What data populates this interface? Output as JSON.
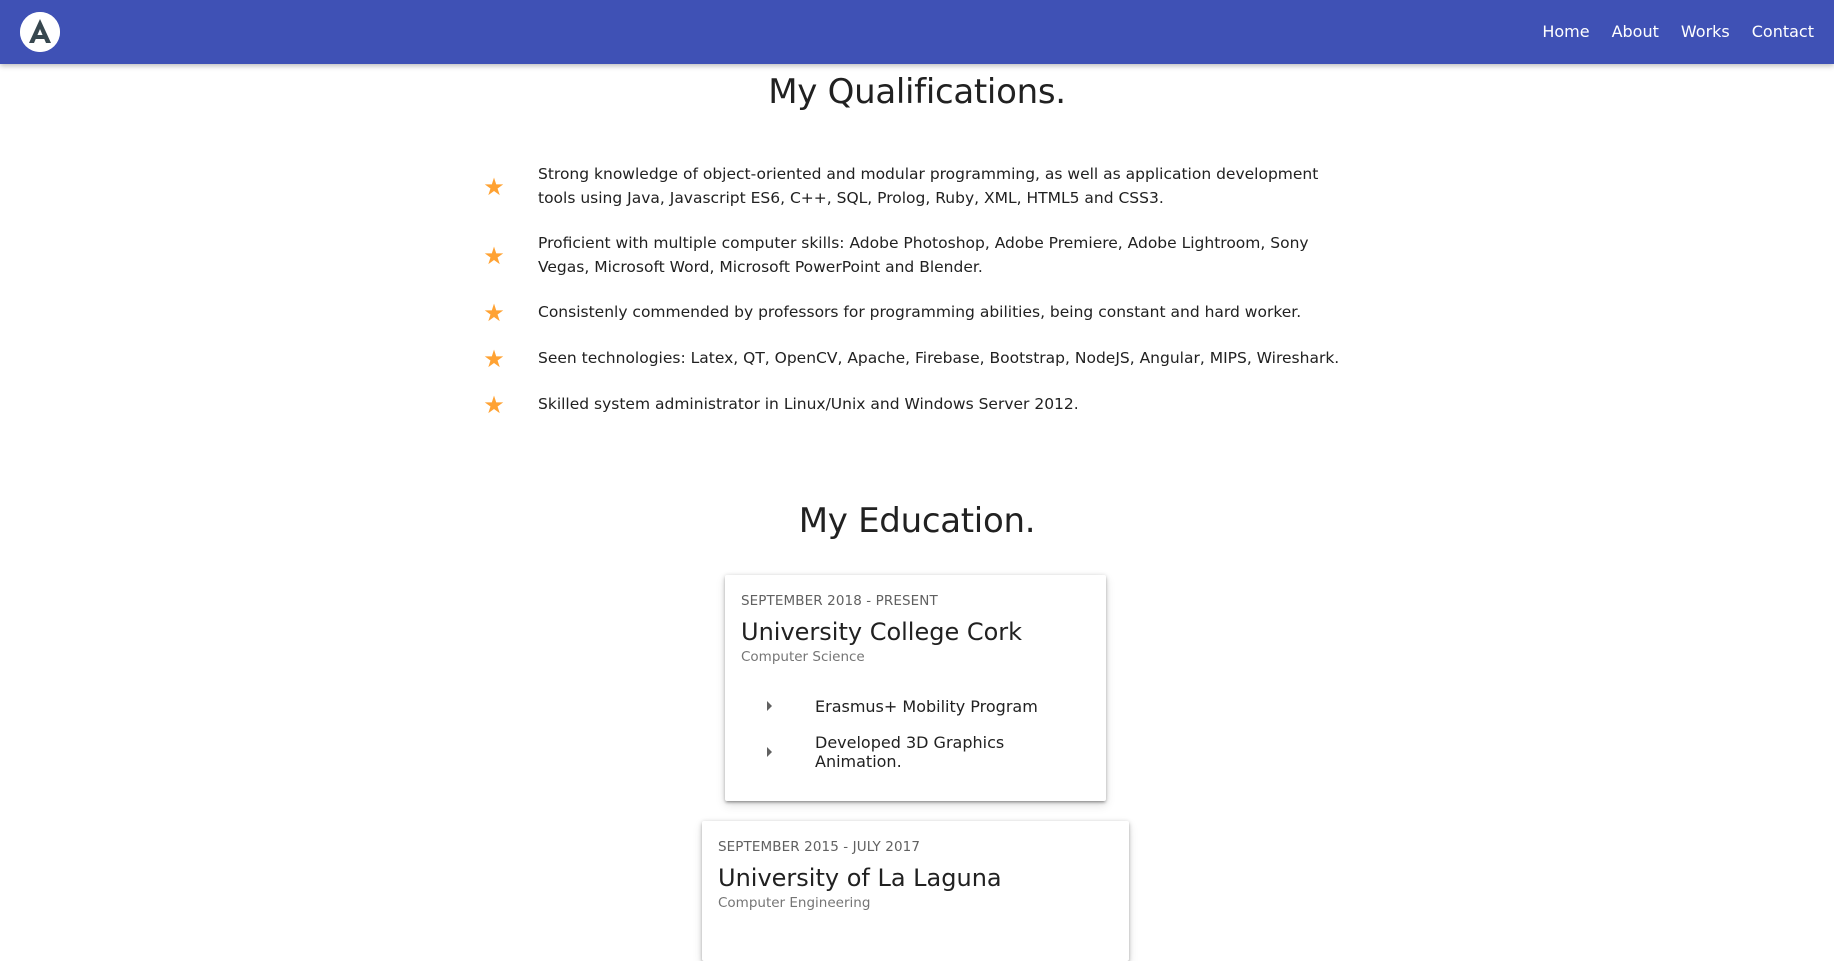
{
  "nav": {
    "links": [
      "Home",
      "About",
      "Works",
      "Contact"
    ]
  },
  "qualifications": {
    "title": "My Qualifications.",
    "items": [
      "Strong knowledge of object-oriented and modular programming, as well as application development tools using Java, Javascript ES6, C++, SQL, Prolog, Ruby, XML, HTML5 and CSS3.",
      "Proficient with multiple computer skills: Adobe Photoshop, Adobe Premiere, Adobe Lightroom, Sony Vegas, Microsoft Word, Microsoft PowerPoint and Blender.",
      "Consistenly commended by professors for programming abilities, being constant and hard worker.",
      "Seen technologies: Latex, QT, OpenCV, Apache, Firebase, Bootstrap, NodeJS, Angular, MIPS, Wireshark.",
      "Skilled system administrator in Linux/Unix and Windows Server 2012."
    ]
  },
  "education": {
    "title": "My Education.",
    "entries": [
      {
        "period": "SEPTEMBER 2018 - PRESENT",
        "school": "University College Cork",
        "degree": "Computer Science",
        "items": [
          "Erasmus+ Mobility Program",
          "Developed 3D Graphics Animation."
        ]
      },
      {
        "period": "SEPTEMBER 2015 - JULY 2017",
        "school": "University of La Laguna",
        "degree": "Computer Engineering",
        "items": []
      }
    ]
  },
  "colors": {
    "navbar": "#3f51b5",
    "star": "#ffa233"
  },
  "icons": {
    "logo": "logo-icon",
    "star": "star-icon",
    "arrow": "arrow-right-icon"
  }
}
